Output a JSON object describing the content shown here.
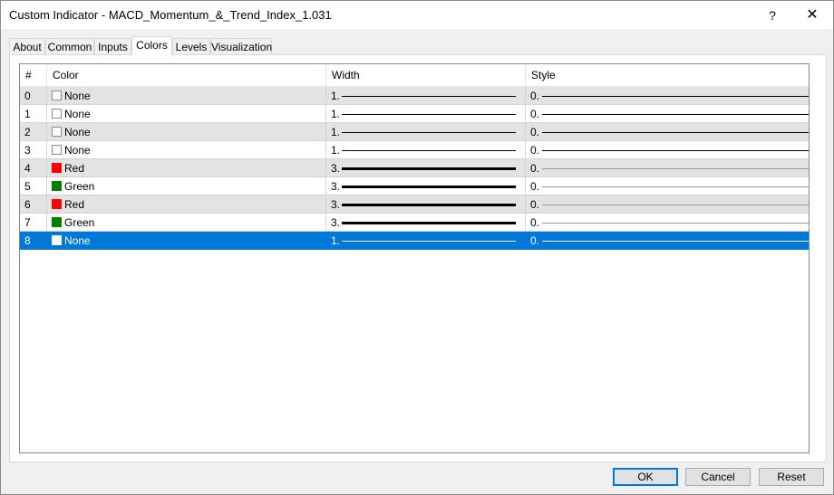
{
  "window": {
    "title": "Custom Indicator - MACD_Momentum_&_Trend_Index_1.031",
    "help_label": "?",
    "close_label": "✕"
  },
  "tabs": [
    {
      "label": "About"
    },
    {
      "label": "Common"
    },
    {
      "label": "Inputs"
    },
    {
      "label": "Colors",
      "active": true
    },
    {
      "label": "Levels"
    },
    {
      "label": "Visualization"
    }
  ],
  "grid": {
    "headers": [
      "#",
      "Color",
      "Width",
      "Style"
    ],
    "rows": [
      {
        "index": "0",
        "color": "None",
        "swatch": "#ffffff",
        "width": "1.",
        "style": "0."
      },
      {
        "index": "1",
        "color": "None",
        "swatch": "#ffffff",
        "width": "1.",
        "style": "0."
      },
      {
        "index": "2",
        "color": "None",
        "swatch": "#ffffff",
        "width": "1.",
        "style": "0."
      },
      {
        "index": "3",
        "color": "None",
        "swatch": "#ffffff",
        "width": "1.",
        "style": "0."
      },
      {
        "index": "4",
        "color": "Red",
        "swatch": "#ff0000",
        "width": "3.",
        "style": "0."
      },
      {
        "index": "5",
        "color": "Green",
        "swatch": "#008000",
        "width": "3.",
        "style": "0."
      },
      {
        "index": "6",
        "color": "Red",
        "swatch": "#ff0000",
        "width": "3.",
        "style": "0."
      },
      {
        "index": "7",
        "color": "Green",
        "swatch": "#008000",
        "width": "3.",
        "style": "0."
      },
      {
        "index": "8",
        "color": "None",
        "swatch": "#ffffff",
        "width": "1.",
        "style": "0.",
        "selected": true
      }
    ]
  },
  "buttons": {
    "ok": "OK",
    "cancel": "Cancel",
    "reset": "Reset"
  },
  "colors": {
    "selection": "#0078d7"
  }
}
